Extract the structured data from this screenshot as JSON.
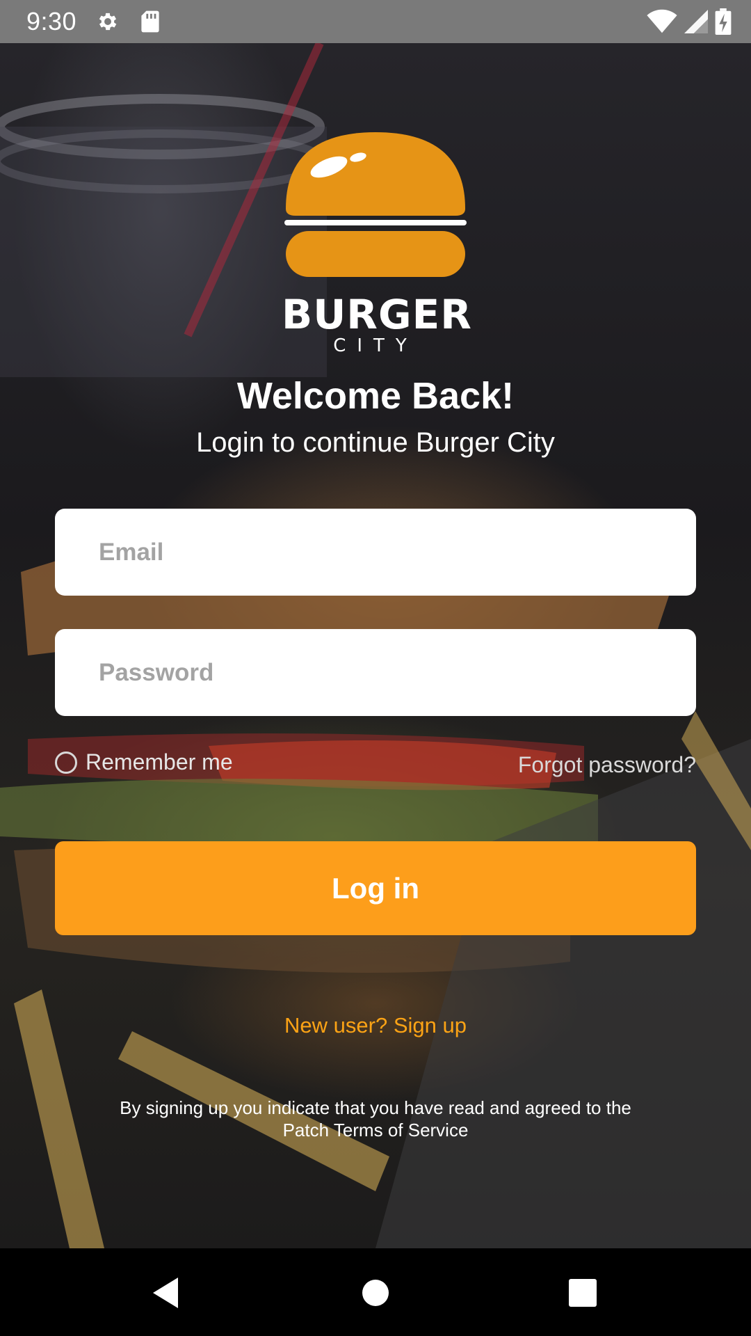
{
  "status_bar": {
    "time": "9:30",
    "icons": [
      "gear-icon",
      "sd-card-icon",
      "wifi-icon",
      "signal-icon",
      "battery-charging-icon"
    ]
  },
  "logo": {
    "word": "BURGER",
    "sub": "CITY",
    "bun_color": "#e69416"
  },
  "header": {
    "title": "Welcome Back!",
    "subtitle": "Login to continue Burger City"
  },
  "form": {
    "email_placeholder": "Email",
    "password_placeholder": "Password",
    "remember_label": "Remember me",
    "remember_checked": false,
    "forgot_label": "Forgot password?",
    "login_label": "Log in",
    "signup_label": "New user? Sign up"
  },
  "footer": {
    "terms_line1": "By signing up you indicate that you have read and agreed to the",
    "terms_line2": "Patch Terms of Service"
  },
  "nav": {
    "buttons": [
      "back-icon",
      "home-icon",
      "recents-icon"
    ]
  },
  "colors": {
    "accent": "#fd9e1b",
    "link": "#fca315"
  }
}
